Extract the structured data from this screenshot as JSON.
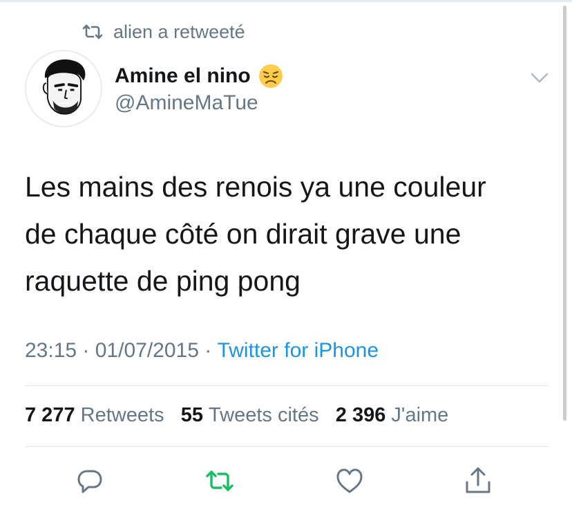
{
  "retweet_banner": {
    "text": "alien a retweeté",
    "icon": "retweet-icon"
  },
  "author": {
    "display_name": "Amine el nino",
    "emoji": "😞",
    "handle": "@AmineMaTue",
    "avatar_icon": "cartoon-face-avatar"
  },
  "tweet": {
    "text_lines": [
      "Les mains des renois ya une couleur",
      "de chaque côté on dirait grave une",
      "raquette de ping pong"
    ],
    "time": "23:15",
    "separator": " · ",
    "date": "01/07/2015",
    "source": "Twitter for iPhone"
  },
  "stats": {
    "retweets_count": "7 277",
    "retweets_label": "Retweets",
    "quotes_count": "55",
    "quotes_label": "Tweets cités",
    "likes_count": "2 396",
    "likes_label": "J'aime"
  },
  "actions": {
    "reply_icon": "reply-icon",
    "retweet_icon": "retweet-icon",
    "like_icon": "heart-icon",
    "share_icon": "share-icon"
  },
  "colors": {
    "accent": "#1b95e0",
    "retweet_green": "#17bf63",
    "secondary_text": "#657786",
    "primary_text": "#14171a"
  }
}
